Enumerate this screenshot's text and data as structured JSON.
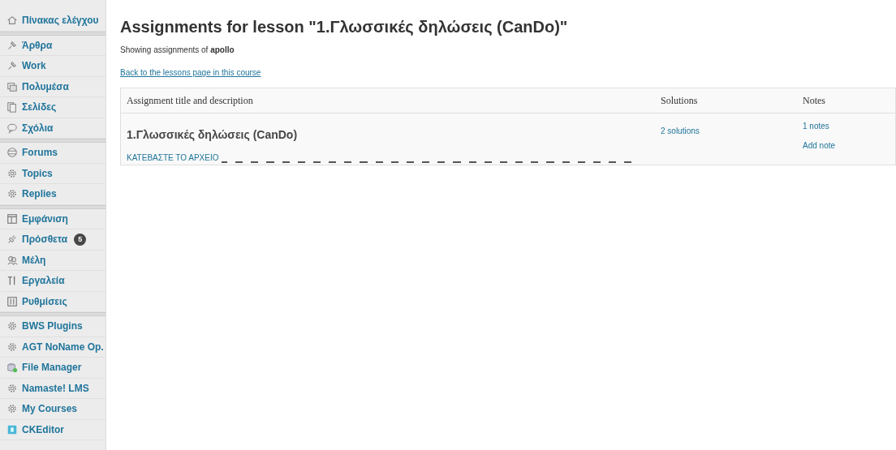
{
  "sidebar": {
    "groups": [
      [
        {
          "label": "Πίνακας ελέγχου",
          "kind": "home"
        }
      ],
      [
        {
          "label": "Άρθρα",
          "kind": "pin"
        },
        {
          "label": "Work",
          "kind": "pin"
        },
        {
          "label": "Πολυμέσα",
          "kind": "media"
        },
        {
          "label": "Σελίδες",
          "kind": "pages"
        },
        {
          "label": "Σχόλια",
          "kind": "comment"
        }
      ],
      [
        {
          "label": "Forums",
          "kind": "globe"
        },
        {
          "label": "Topics",
          "kind": "gear"
        },
        {
          "label": "Replies",
          "kind": "gear"
        }
      ],
      [
        {
          "label": "Εμφάνιση",
          "kind": "window"
        },
        {
          "label": "Πρόσθετα",
          "kind": "plug",
          "badge": "5"
        },
        {
          "label": "Μέλη",
          "kind": "users"
        },
        {
          "label": "Εργαλεία",
          "kind": "tools"
        },
        {
          "label": "Ρυθμίσεις",
          "kind": "settings"
        }
      ],
      [
        {
          "label": "BWS Plugins",
          "kind": "gear"
        },
        {
          "label": "AGT NoName Op.",
          "kind": "gear"
        },
        {
          "label": "File Manager",
          "kind": "files"
        },
        {
          "label": "Namaste! LMS",
          "kind": "gear"
        },
        {
          "label": "My Courses",
          "kind": "gear"
        },
        {
          "label": "CKEditor",
          "kind": "editor"
        }
      ]
    ]
  },
  "page": {
    "title": "Assignments for lesson \"1.Γλωσσικές δηλώσεις (CanDo)\"",
    "subtitle": "Showing assignments of **apollo**",
    "back_link": "Back to the lessons page in this course"
  },
  "table": {
    "columns": [
      "Assignment title and description",
      "Solutions",
      "Notes"
    ],
    "rows": [
      {
        "title": "1.Γλωσσικές δηλώσεις (CanDo)",
        "file_link": "ΚΑΤΕΒΑΣΤΕ ΤΟ ΑΡΧΕΙΟ",
        "solutions": "2 solutions",
        "notes": "1 notes",
        "add_note": "Add note"
      }
    ]
  }
}
